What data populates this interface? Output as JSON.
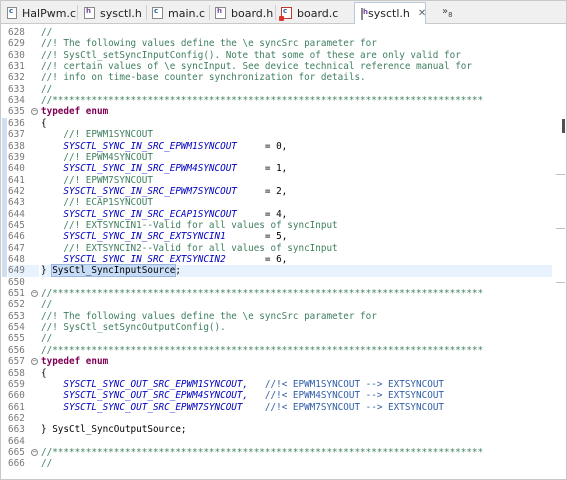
{
  "tabs": [
    {
      "name": "HalPwm.c",
      "kind": "c",
      "error": false,
      "active": false
    },
    {
      "name": "sysctl.h",
      "kind": "h",
      "error": false,
      "active": false
    },
    {
      "name": "main.c",
      "kind": "c",
      "error": false,
      "active": false
    },
    {
      "name": "board.h",
      "kind": "h",
      "error": false,
      "active": false
    },
    {
      "name": "board.c",
      "kind": "c",
      "error": true,
      "active": false
    },
    {
      "name": "sysctl.h",
      "kind": "h",
      "error": false,
      "active": true
    }
  ],
  "close_glyph": "✕",
  "overflow": {
    "arrows": "»",
    "count": "8"
  },
  "fold_glyph": "−",
  "highlight_line": "649",
  "lines": [
    {
      "n": "628",
      "t": [
        [
          "cm",
          "//"
        ]
      ]
    },
    {
      "n": "629",
      "t": [
        [
          "cm",
          "//! The following values define the \\e syncSrc parameter for"
        ]
      ]
    },
    {
      "n": "630",
      "t": [
        [
          "cm",
          "//! SysCtl_setSyncInputConfig(). Note that some of these are only valid for"
        ]
      ]
    },
    {
      "n": "631",
      "t": [
        [
          "cm",
          "//! certain values of \\e syncInput. See device technical reference manual for"
        ]
      ]
    },
    {
      "n": "632",
      "t": [
        [
          "cm",
          "//! info on time-base counter synchronization for details."
        ]
      ]
    },
    {
      "n": "633",
      "t": [
        [
          "cm",
          "//"
        ]
      ]
    },
    {
      "n": "634",
      "t": [
        [
          "cm",
          "//*****************************************************************************"
        ]
      ]
    },
    {
      "n": "635",
      "fold": true,
      "t": [
        [
          "k",
          "typedef"
        ],
        [
          "tx",
          " "
        ],
        [
          "k",
          "enum"
        ]
      ]
    },
    {
      "n": "636",
      "t": [
        [
          "tx",
          "{"
        ]
      ]
    },
    {
      "n": "637",
      "t": [
        [
          "tx",
          "    "
        ],
        [
          "cm",
          "//! EPWM1SYNCOUT"
        ]
      ]
    },
    {
      "n": "638",
      "t": [
        [
          "tx",
          "    "
        ],
        [
          "en",
          "SYSCTL_SYNC_IN_SRC_EPWM1SYNCOUT"
        ],
        [
          "tx",
          "     = 0,"
        ]
      ]
    },
    {
      "n": "639",
      "t": [
        [
          "tx",
          "    "
        ],
        [
          "cm",
          "//! EPWM4SYNCOUT"
        ]
      ]
    },
    {
      "n": "640",
      "t": [
        [
          "tx",
          "    "
        ],
        [
          "en",
          "SYSCTL_SYNC_IN_SRC_EPWM4SYNCOUT"
        ],
        [
          "tx",
          "     = 1,"
        ]
      ]
    },
    {
      "n": "641",
      "t": [
        [
          "tx",
          "    "
        ],
        [
          "cm",
          "//! EPWM7SYNCOUT"
        ]
      ]
    },
    {
      "n": "642",
      "t": [
        [
          "tx",
          "    "
        ],
        [
          "en",
          "SYSCTL_SYNC_IN_SRC_EPWM7SYNCOUT"
        ],
        [
          "tx",
          "     = 2,"
        ]
      ]
    },
    {
      "n": "643",
      "t": [
        [
          "tx",
          "    "
        ],
        [
          "cm",
          "//! ECAP1SYNCOUT"
        ]
      ]
    },
    {
      "n": "644",
      "t": [
        [
          "tx",
          "    "
        ],
        [
          "en",
          "SYSCTL_SYNC_IN_SRC_ECAP1SYNCOUT"
        ],
        [
          "tx",
          "     = 4,"
        ]
      ]
    },
    {
      "n": "645",
      "t": [
        [
          "tx",
          "    "
        ],
        [
          "cm",
          "//! EXTSYNCIN1--Valid for all values of syncInput"
        ]
      ]
    },
    {
      "n": "646",
      "t": [
        [
          "tx",
          "    "
        ],
        [
          "en",
          "SYSCTL_SYNC_IN_SRC_EXTSYNCIN1"
        ],
        [
          "tx",
          "       = 5,"
        ]
      ]
    },
    {
      "n": "647",
      "t": [
        [
          "tx",
          "    "
        ],
        [
          "cm",
          "//! EXTSYNCIN2--Valid for all values of syncInput"
        ]
      ]
    },
    {
      "n": "648",
      "t": [
        [
          "tx",
          "    "
        ],
        [
          "en",
          "SYSCTL_SYNC_IN_SRC_EXTSYNCIN2"
        ],
        [
          "tx",
          "       = 6,"
        ]
      ]
    },
    {
      "n": "649",
      "t": [
        [
          "tx",
          "} "
        ],
        [
          "sel",
          "SysCtl_SyncInputSource"
        ],
        [
          "tx",
          ";"
        ]
      ]
    },
    {
      "n": "650",
      "t": []
    },
    {
      "n": "651",
      "fold": true,
      "t": [
        [
          "cm",
          "//*****************************************************************************"
        ]
      ]
    },
    {
      "n": "652",
      "t": [
        [
          "cm",
          "//"
        ]
      ]
    },
    {
      "n": "653",
      "t": [
        [
          "cm",
          "//! The following values define the \\e syncSrc parameter for"
        ]
      ]
    },
    {
      "n": "654",
      "t": [
        [
          "cm",
          "//! SysCtl_setSyncOutputConfig()."
        ]
      ]
    },
    {
      "n": "655",
      "t": [
        [
          "cm",
          "//"
        ]
      ]
    },
    {
      "n": "656",
      "t": [
        [
          "cm",
          "//*****************************************************************************"
        ]
      ]
    },
    {
      "n": "657",
      "fold": true,
      "t": [
        [
          "k",
          "typedef"
        ],
        [
          "tx",
          " "
        ],
        [
          "k",
          "enum"
        ]
      ]
    },
    {
      "n": "658",
      "t": [
        [
          "tx",
          "{"
        ]
      ]
    },
    {
      "n": "659",
      "t": [
        [
          "tx",
          "    "
        ],
        [
          "en",
          "SYSCTL_SYNC_OUT_SRC_EPWM1SYNCOUT,"
        ],
        [
          "tx",
          "   "
        ],
        [
          "cmx",
          "//!< EPWM1SYNCOUT --> EXTSYNCOUT"
        ]
      ]
    },
    {
      "n": "660",
      "t": [
        [
          "tx",
          "    "
        ],
        [
          "en",
          "SYSCTL_SYNC_OUT_SRC_EPWM4SYNCOUT,"
        ],
        [
          "tx",
          "   "
        ],
        [
          "cmx",
          "//!< EPWM4SYNCOUT --> EXTSYNCOUT"
        ]
      ]
    },
    {
      "n": "661",
      "t": [
        [
          "tx",
          "    "
        ],
        [
          "en",
          "SYSCTL_SYNC_OUT_SRC_EPWM7SYNCOUT"
        ],
        [
          "tx",
          "    "
        ],
        [
          "cmx",
          "//!< EPWM7SYNCOUT --> EXTSYNCOUT"
        ]
      ]
    },
    {
      "n": "662",
      "t": []
    },
    {
      "n": "663",
      "t": [
        [
          "tx",
          "} SysCtl_SyncOutputSource;"
        ]
      ]
    },
    {
      "n": "664",
      "t": []
    },
    {
      "n": "665",
      "fold": true,
      "t": [
        [
          "cm",
          "//*****************************************************************************"
        ]
      ]
    },
    {
      "n": "666",
      "t": [
        [
          "cm",
          "//"
        ]
      ]
    }
  ]
}
